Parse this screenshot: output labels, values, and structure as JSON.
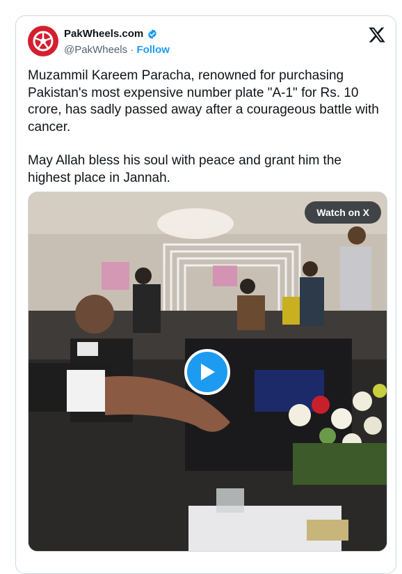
{
  "tweet": {
    "author": {
      "display_name": "PakWheels.com",
      "handle": "@PakWheels",
      "separator": "·",
      "follow_label": "Follow",
      "verified_icon": "verified-badge-icon",
      "avatar_icon": "pakwheels-logo-icon"
    },
    "platform_icon": "x-logo-icon",
    "text_paragraph_1": "Muzammil Kareem Paracha, renowned for purchasing Pakistan's most expensive number plate \"A-1\" for Rs. 10 crore, has sadly passed away after a courageous battle with cancer.",
    "text_paragraph_2": "May Allah bless his soul with peace and grant him the highest place in Jannah.",
    "media": {
      "watch_label": "Watch on X",
      "play_icon": "play-icon"
    }
  },
  "colors": {
    "accent": "#1d9bf0",
    "brand_red": "#d41f2f",
    "text": "#0f1419",
    "muted": "#536471",
    "border": "#cfd9de"
  }
}
